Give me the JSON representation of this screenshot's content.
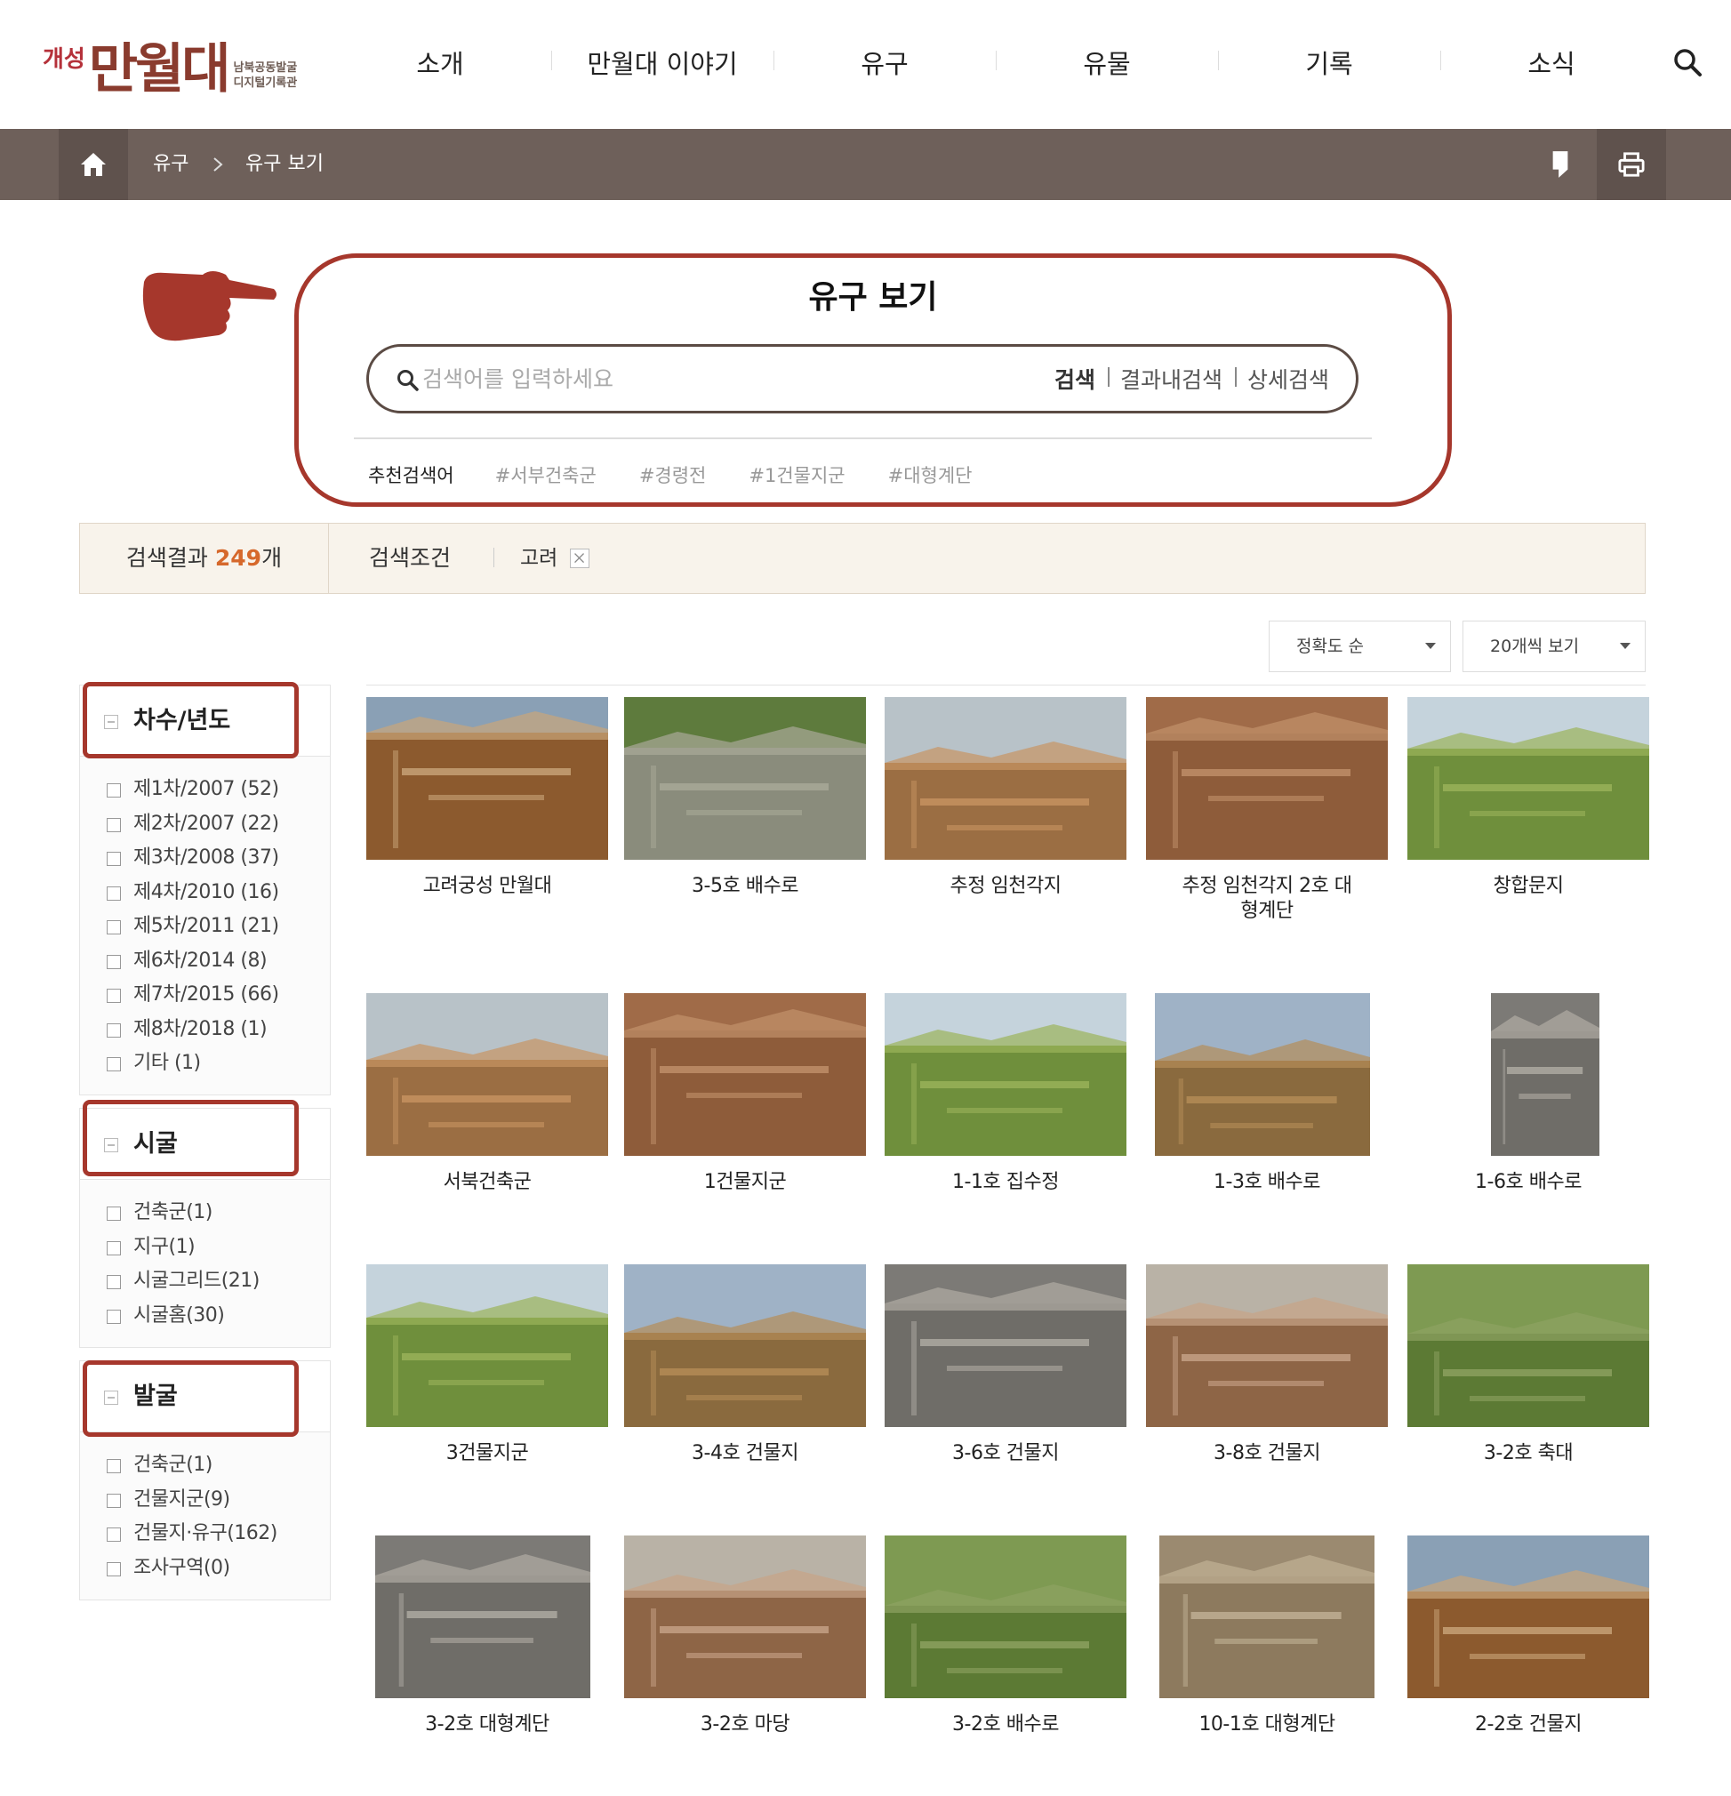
{
  "logo": {
    "small": "개성",
    "main": "만월대",
    "sub_line1": "남북공동발굴",
    "sub_line2": "디지털기록관"
  },
  "nav": [
    "소개",
    "만월대 이야기",
    "유구",
    "유물",
    "기록",
    "소식"
  ],
  "breadcrumb": {
    "level1": "유구",
    "level2": "유구 보기"
  },
  "icons": {
    "home": "home-icon",
    "search": "search-icon",
    "share": "bookmark-icon",
    "print": "printer-icon",
    "hand": "pointing-hand-icon"
  },
  "colors": {
    "accent_red": "#a6372c",
    "bar_brown": "#6e605a",
    "count_orange": "#d6682b",
    "result_bg": "#f8f3eb"
  },
  "search": {
    "title": "유구 보기",
    "placeholder": "검색어를 입력하세요",
    "buttons": [
      "검색",
      "결과내검색",
      "상세검색"
    ],
    "recommend_label": "추천검색어",
    "recommend_tags": [
      "#서부건축군",
      "#경령전",
      "#1건물지군",
      "#대형계단"
    ]
  },
  "results": {
    "label": "검색결과 ",
    "count": "249",
    "unit": "개",
    "condition_label": "검색조건",
    "condition_tag": "고려"
  },
  "sort": {
    "order": "정확도 순",
    "per_page": "20개씩 보기"
  },
  "facets": [
    {
      "title": "차수/년도",
      "items": [
        "제1차/2007 (52)",
        "제2차/2007 (22)",
        "제3차/2008 (37)",
        "제4차/2010 (16)",
        "제5차/2011 (21)",
        "제6차/2014 (8)",
        "제7차/2015 (66)",
        "제8차/2018 (1)",
        "기타 (1)"
      ]
    },
    {
      "title": "시굴",
      "items": [
        "건축군(1)",
        "지구(1)",
        "시굴그리드(21)",
        "시굴홈(30)"
      ]
    },
    {
      "title": "발굴",
      "items": [
        "건축군(1)",
        "건물지군(9)",
        "건물지·유구(162)",
        "조사구역(0)"
      ]
    }
  ],
  "items": [
    {
      "caption": "고려궁성 만월대"
    },
    {
      "caption": "3-5호 배수로"
    },
    {
      "caption": "추정 임천각지"
    },
    {
      "caption": "추정 임천각지 2호 대형계단"
    },
    {
      "caption": "창합문지"
    },
    {
      "caption": "서북건축군"
    },
    {
      "caption": "1건물지군"
    },
    {
      "caption": "1-1호 집수정"
    },
    {
      "caption": "1-3호 배수로"
    },
    {
      "caption": "1-6호 배수로"
    },
    {
      "caption": "3건물지군"
    },
    {
      "caption": "3-4호 건물지"
    },
    {
      "caption": "3-6호 건물지"
    },
    {
      "caption": "3-8호 건물지"
    },
    {
      "caption": "3-2호 축대"
    },
    {
      "caption": "3-2호 대형계단"
    },
    {
      "caption": "3-2호 마당"
    },
    {
      "caption": "3-2호 배수로"
    },
    {
      "caption": "10-1호 대형계단"
    },
    {
      "caption": "2-2호 건물지"
    }
  ]
}
